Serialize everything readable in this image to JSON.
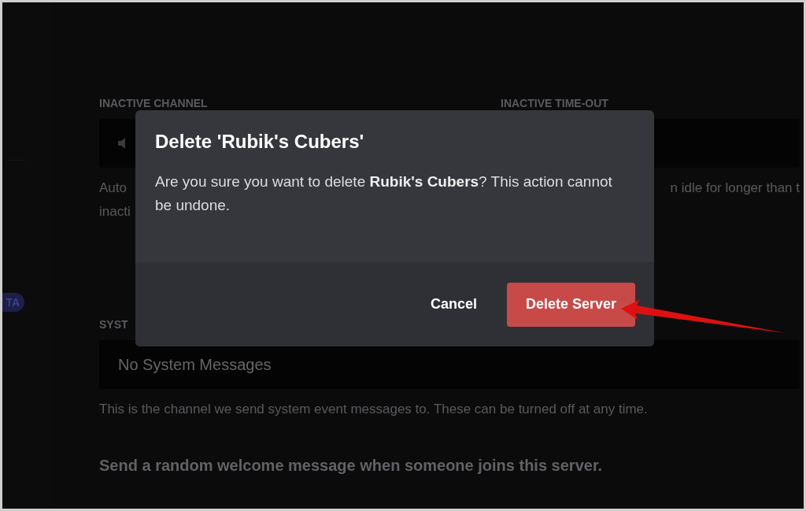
{
  "sidebar": {
    "badge": "TA"
  },
  "settings": {
    "inactive_channel_label": "INACTIVE CHANNEL",
    "inactive_timeout_label": "INACTIVE TIME-OUT",
    "inactive_help_start": "Auto",
    "inactive_help_end": "n idle for longer than t",
    "inactive_help_line2": "inacti",
    "system_label": "SYST",
    "system_channel_value": "No System Messages",
    "system_help": "This is the channel we send system event messages to. These can be turned off at any time.",
    "welcome_option": "Send a random welcome message when someone joins this server."
  },
  "dialog": {
    "title": "Delete 'Rubik's Cubers'",
    "message": "Are you sure you want to delete **Rubik's Cubers**? This action cannot be undone.",
    "buttons": [
      {
        "label": "Cancel",
        "kind": "link"
      },
      {
        "label": "Delete Server",
        "kind": "danger"
      }
    ]
  }
}
